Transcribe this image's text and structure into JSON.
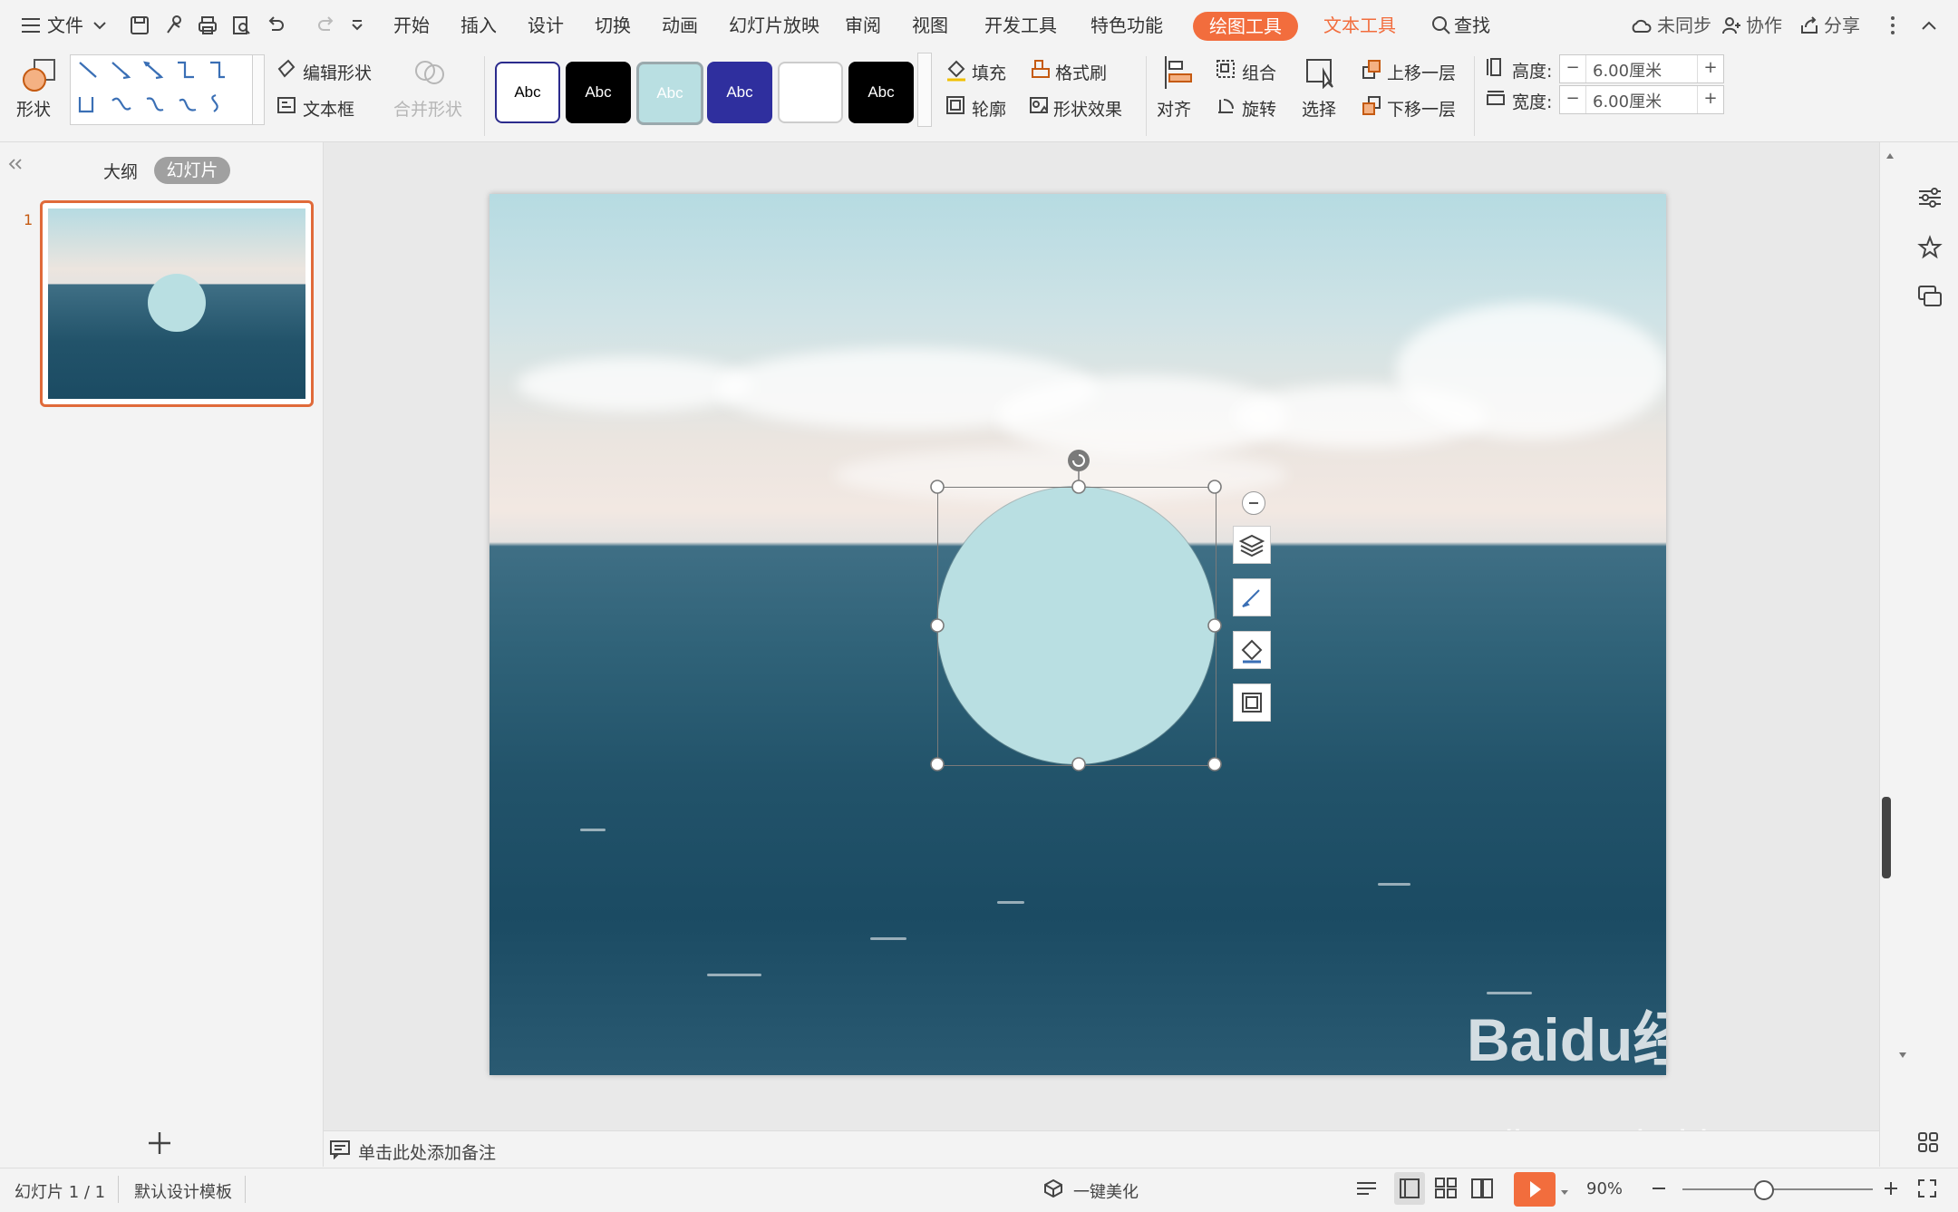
{
  "menu": {
    "file_label": "文件",
    "tabs": [
      "开始",
      "插入",
      "设计",
      "切换",
      "动画",
      "幻灯片放映",
      "审阅",
      "视图",
      "开发工具",
      "特色功能"
    ],
    "drawing_tools": "绘图工具",
    "text_tools": "文本工具",
    "search_label": "查找",
    "sync_label": "未同步",
    "collab_label": "协作",
    "share_label": "分享"
  },
  "ribbon": {
    "shape_label": "形状",
    "edit_shape_label": "编辑形状",
    "textbox_label": "文本框",
    "merge_shape_label": "合并形状",
    "styles": [
      {
        "label": "Abc",
        "bg": "#ffffff",
        "fg": "#000000",
        "border": "#2b2b8c"
      },
      {
        "label": "Abc",
        "bg": "#000000",
        "fg": "#ffffff",
        "border": "#000000"
      },
      {
        "label": "Abc",
        "bg": "#b9dfe2",
        "fg": "#ffffff",
        "border": "#9aa9ad"
      },
      {
        "label": "Abc",
        "bg": "#2f2f9e",
        "fg": "#ffffff",
        "border": "#2f2f9e"
      },
      {
        "label": "",
        "bg": "#ffffff",
        "fg": "#000000",
        "border": "#cccccc"
      },
      {
        "label": "Abc",
        "bg": "#000000",
        "fg": "#ffffff",
        "border": "#000000"
      }
    ],
    "fill_label": "填充",
    "format_painter_label": "格式刷",
    "outline_label": "轮廓",
    "shape_effect_label": "形状效果",
    "align_label": "对齐",
    "group_label": "组合",
    "rotate_label": "旋转",
    "select_label": "选择",
    "bring_forward_label": "上移一层",
    "send_backward_label": "下移一层",
    "height_label": "高度:",
    "height_value": "6.00厘米",
    "width_label": "宽度:",
    "width_value": "6.00厘米"
  },
  "left_panel": {
    "outline_tab": "大纲",
    "slides_tab": "幻灯片",
    "slide_number": "1"
  },
  "notes_placeholder": "单击此处添加备注",
  "status": {
    "slide_info": "幻灯片 1 / 1",
    "template": "默认设计模板",
    "beautify": "一键美化",
    "zoom": "90%"
  },
  "watermark": {
    "brand": "Baidu经验",
    "url": "jingyan.baidu.com"
  },
  "colors": {
    "accent": "#f26d3d",
    "circle_fill": "#b9dfe2",
    "selection_border": "#7a7a7a"
  },
  "icons": {
    "shape": "shapes-icon",
    "fill": "paint-bucket-icon",
    "play": "play-icon"
  }
}
